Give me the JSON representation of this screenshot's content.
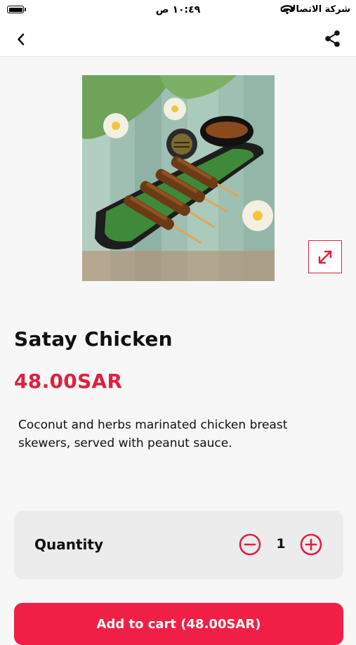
{
  "status_bar": {
    "carrier": "شركة الاتصالات",
    "time": "١٠:٤٩ ص",
    "icons": [
      "battery-icon",
      "wifi-icon"
    ]
  },
  "nav": {
    "back_icon": "chevron-left-icon",
    "share_icon": "share-icon"
  },
  "product": {
    "name": "Satay Chicken",
    "price": "48.00SAR",
    "description": "Coconut and herbs marinated chicken breast skewers, served with peanut sauce.",
    "image_icon": "expand-icon"
  },
  "quantity": {
    "label": "Quantity",
    "value": "1",
    "minus_icon": "minus-circle-icon",
    "plus_icon": "plus-circle-icon"
  },
  "cart": {
    "button_label": "Add to cart (48.00SAR)"
  },
  "colors": {
    "accent": "#e0203f",
    "button": "#f01f46",
    "background": "#f7f7f7",
    "card": "#ececec"
  }
}
